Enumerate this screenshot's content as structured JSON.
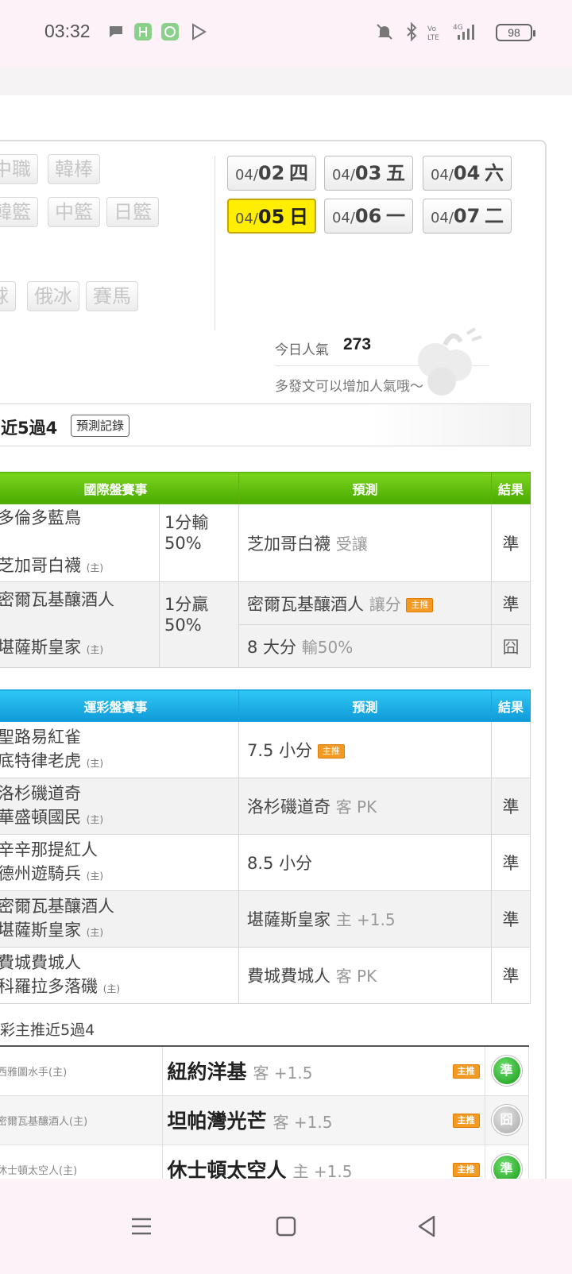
{
  "status_bar": {
    "time": "03:32",
    "battery": "98"
  },
  "sports_tags": [
    {
      "label": "中職"
    },
    {
      "label": "韓棒"
    },
    {
      "label": "韓籃"
    },
    {
      "label": "中籃"
    },
    {
      "label": "日籃"
    },
    {
      "label": "球"
    },
    {
      "label": "俄冰"
    },
    {
      "label": "賽馬"
    }
  ],
  "dates": [
    {
      "md": "04/",
      "day": "02",
      "wd": "四"
    },
    {
      "md": "04/",
      "day": "03",
      "wd": "五"
    },
    {
      "md": "04/",
      "day": "04",
      "wd": "六"
    },
    {
      "md": "04/",
      "day": "05",
      "wd": "日",
      "active": true
    },
    {
      "md": "04/",
      "day": "06",
      "wd": "一"
    },
    {
      "md": "04/",
      "day": "07",
      "wd": "二"
    }
  ],
  "popularity": {
    "label": "今日人氣",
    "value": "273",
    "hint": "多發文可以增加人氣哦～"
  },
  "record_bar": {
    "text": "近5過4",
    "button": "預測記錄"
  },
  "intl_table": {
    "headers": [
      "國際盤賽事",
      "預測",
      "結果"
    ],
    "rows": [
      {
        "away": "多倫多藍鳥",
        "home": "芝加哥白襪",
        "home_tag": "(主)",
        "line1": "1分輸",
        "line2": "50%",
        "pick": "芝加哥白襪",
        "pick_note": "受讓",
        "result": "準"
      },
      {
        "away": "密爾瓦基釀酒人",
        "home": "堪薩斯皇家",
        "home_tag": "(主)",
        "line1": "1分贏",
        "line2": "50%",
        "pick": "密爾瓦基釀酒人",
        "pick_note": "讓分",
        "badge": "主推",
        "result": "準",
        "pick2": "8 大分",
        "pick2_note": "輸50%",
        "result2": "囧"
      }
    ]
  },
  "sports_lottery_table": {
    "headers": [
      "運彩盤賽事",
      "預測",
      "結果"
    ],
    "rows": [
      {
        "away": "聖路易紅雀",
        "home": "底特律老虎",
        "home_tag": "(主)",
        "pick": "7.5 小分",
        "pick_note": "",
        "badge": "主推",
        "result": ""
      },
      {
        "away": "洛杉磯道奇",
        "home": "華盛頓國民",
        "home_tag": "(主)",
        "pick": "洛杉磯道奇",
        "pick_note": "客 PK",
        "result": "準"
      },
      {
        "away": "辛辛那提紅人",
        "home": "德州遊騎兵",
        "home_tag": "(主)",
        "pick": "8.5 小分",
        "pick_note": "",
        "result": "準"
      },
      {
        "away": "密爾瓦基釀酒人",
        "home": "堪薩斯皇家",
        "home_tag": "(主)",
        "pick": "堪薩斯皇家",
        "pick_note": "主 +1.5",
        "result": "準"
      },
      {
        "away": "費城費城人",
        "home": "科羅拉多落磯",
        "home_tag": "(主)",
        "pick": "費城費城人",
        "pick_note": "客 PK",
        "result": "準"
      }
    ]
  },
  "main_pick_section": {
    "title": "彩主推近5過4",
    "rows": [
      {
        "team": "西雅圖水手(主)",
        "pick": "紐約洋基",
        "pick_note": "客 +1.5",
        "badge": "主推",
        "result": "準"
      },
      {
        "team": "密爾瓦基釀酒人(主)",
        "pick": "坦帕灣光芒",
        "pick_note": "客 +1.5",
        "badge": "主推",
        "result": "囧"
      },
      {
        "team": "休士頓太空人(主)",
        "pick": "休士頓太空人",
        "pick_note": "主 +1.5",
        "badge": "主推",
        "result": "準"
      }
    ]
  }
}
